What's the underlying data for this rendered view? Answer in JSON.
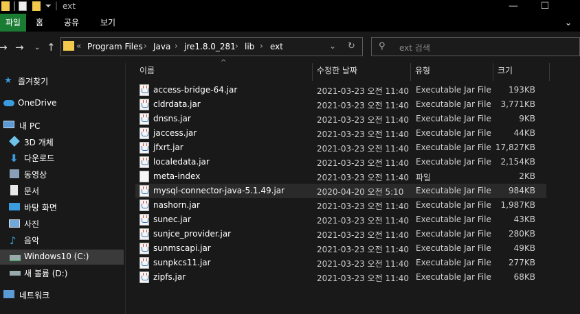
{
  "window": {
    "title": "ext",
    "minimize": "—",
    "maximize": "☐"
  },
  "ribbon": {
    "tabs": [
      "파일",
      "홈",
      "공유",
      "보기"
    ]
  },
  "nav": {
    "breadcrumbs": [
      "Program Files",
      "Java",
      "jre1.8.0_281",
      "lib",
      "ext"
    ],
    "search_placeholder": "ext 검색"
  },
  "sidebar": {
    "items": [
      {
        "label": "즐겨찾기",
        "icon": "star-icon"
      },
      {
        "label": "OneDrive",
        "icon": "cloud-icon"
      },
      {
        "label": "내 PC",
        "icon": "computer-icon"
      },
      {
        "label": "3D 개체",
        "icon": "cube-icon"
      },
      {
        "label": "다운로드",
        "icon": "download-icon"
      },
      {
        "label": "동영상",
        "icon": "video-icon"
      },
      {
        "label": "문서",
        "icon": "document-icon"
      },
      {
        "label": "바탕 화면",
        "icon": "desktop-icon"
      },
      {
        "label": "사진",
        "icon": "picture-icon"
      },
      {
        "label": "음악",
        "icon": "music-icon"
      },
      {
        "label": "Windows10 (C:)",
        "icon": "drive-icon"
      },
      {
        "label": "새 볼륨 (D:)",
        "icon": "drive-icon"
      },
      {
        "label": "네트워크",
        "icon": "network-icon"
      }
    ]
  },
  "columns": {
    "name": "이름",
    "date": "수정한 날짜",
    "type": "유형",
    "size": "크기"
  },
  "files": [
    {
      "name": "access-bridge-64.jar",
      "date": "2021-03-23 오전 11:40",
      "type": "Executable Jar File",
      "size": "193KB"
    },
    {
      "name": "cldrdata.jar",
      "date": "2021-03-23 오전 11:40",
      "type": "Executable Jar File",
      "size": "3,771KB"
    },
    {
      "name": "dnsns.jar",
      "date": "2021-03-23 오전 11:40",
      "type": "Executable Jar File",
      "size": "9KB"
    },
    {
      "name": "jaccess.jar",
      "date": "2021-03-23 오전 11:40",
      "type": "Executable Jar File",
      "size": "44KB"
    },
    {
      "name": "jfxrt.jar",
      "date": "2021-03-23 오전 11:40",
      "type": "Executable Jar File",
      "size": "17,827KB"
    },
    {
      "name": "localedata.jar",
      "date": "2021-03-23 오전 11:40",
      "type": "Executable Jar File",
      "size": "2,154KB"
    },
    {
      "name": "meta-index",
      "date": "2021-03-23 오전 11:40",
      "type": "파일",
      "size": "2KB"
    },
    {
      "name": "mysql-connector-java-5.1.49.jar",
      "date": "2020-04-20 오전 5:10",
      "type": "Executable Jar File",
      "size": "984KB"
    },
    {
      "name": "nashorn.jar",
      "date": "2021-03-23 오전 11:40",
      "type": "Executable Jar File",
      "size": "1,987KB"
    },
    {
      "name": "sunec.jar",
      "date": "2021-03-23 오전 11:40",
      "type": "Executable Jar File",
      "size": "43KB"
    },
    {
      "name": "sunjce_provider.jar",
      "date": "2021-03-23 오전 11:40",
      "type": "Executable Jar File",
      "size": "280KB"
    },
    {
      "name": "sunmscapi.jar",
      "date": "2021-03-23 오전 11:40",
      "type": "Executable Jar File",
      "size": "49KB"
    },
    {
      "name": "sunpkcs11.jar",
      "date": "2021-03-23 오전 11:40",
      "type": "Executable Jar File",
      "size": "277KB"
    },
    {
      "name": "zipfs.jar",
      "date": "2021-03-23 오전 11:40",
      "type": "Executable Jar File",
      "size": "68KB"
    }
  ],
  "colors": {
    "accent_file_tab": "#1a7b33",
    "background": "#191919",
    "folder": "#f2c94c"
  }
}
